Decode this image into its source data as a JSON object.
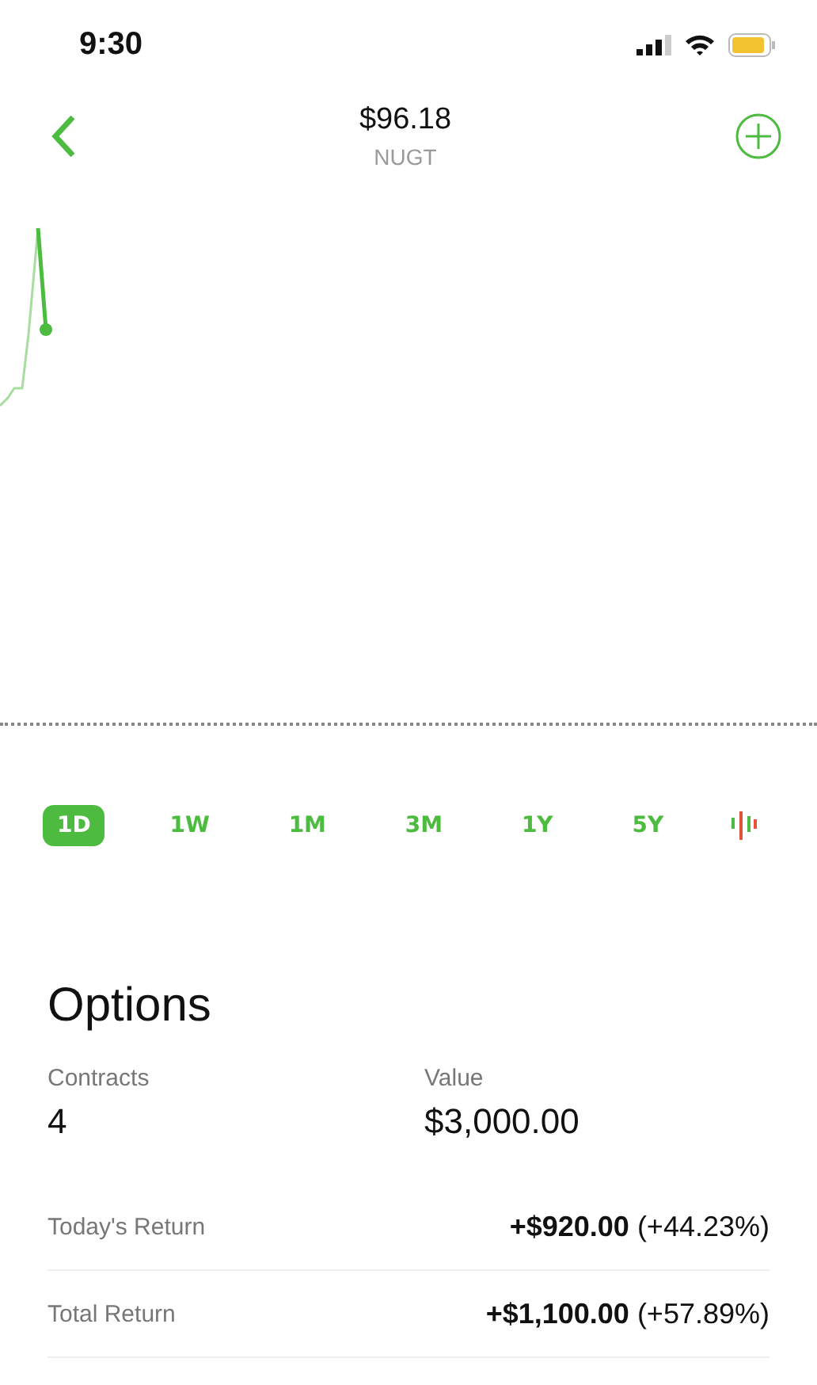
{
  "status_bar": {
    "time": "9:30"
  },
  "header": {
    "price": "$96.18",
    "symbol": "NUGT"
  },
  "ranges": [
    {
      "label": "1D",
      "selected": true
    },
    {
      "label": "1W",
      "selected": false
    },
    {
      "label": "1M",
      "selected": false
    },
    {
      "label": "3M",
      "selected": false
    },
    {
      "label": "1Y",
      "selected": false
    },
    {
      "label": "5Y",
      "selected": false
    }
  ],
  "options": {
    "title": "Options",
    "stats": [
      {
        "label": "Contracts",
        "value": "4"
      },
      {
        "label": "Value",
        "value": "$3,000.00"
      }
    ],
    "returns": [
      {
        "label": "Today's Return",
        "value": "**+$920.00** (+44.23%)"
      },
      {
        "label": "Total Return",
        "value": "**+$1,100.00** (+57.89%)"
      }
    ]
  }
}
